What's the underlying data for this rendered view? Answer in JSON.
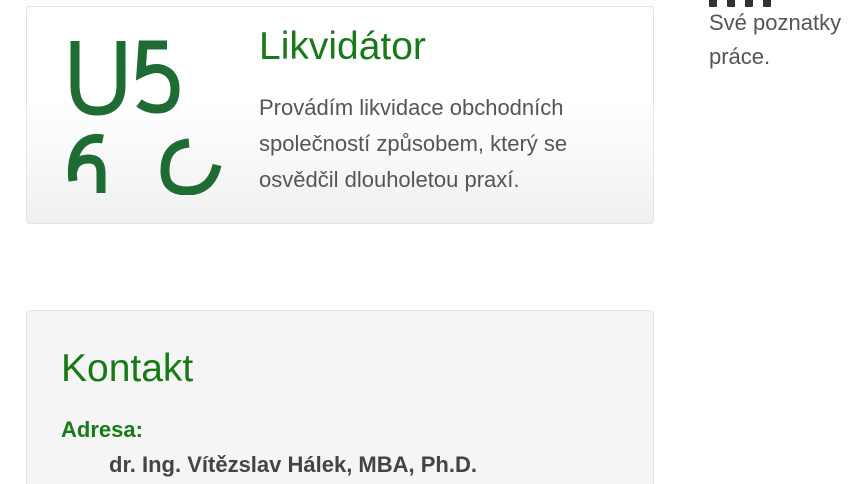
{
  "liquidator": {
    "logo_text": "U56 logo",
    "title": "Likvidátor",
    "description": "Provádím likvidace obchodních společností způsobem, který se  osvědčil dlouholetou praxí."
  },
  "side_text": "Své poznatky\npráce.",
  "contact": {
    "title": "Kontakt",
    "address_label": "Adresa:",
    "name": "dr. Ing. Vítězslav Hálek, MBA, Ph.D."
  },
  "colors": {
    "accent_green": "#177a17",
    "logo_green": "#1e6b33"
  }
}
